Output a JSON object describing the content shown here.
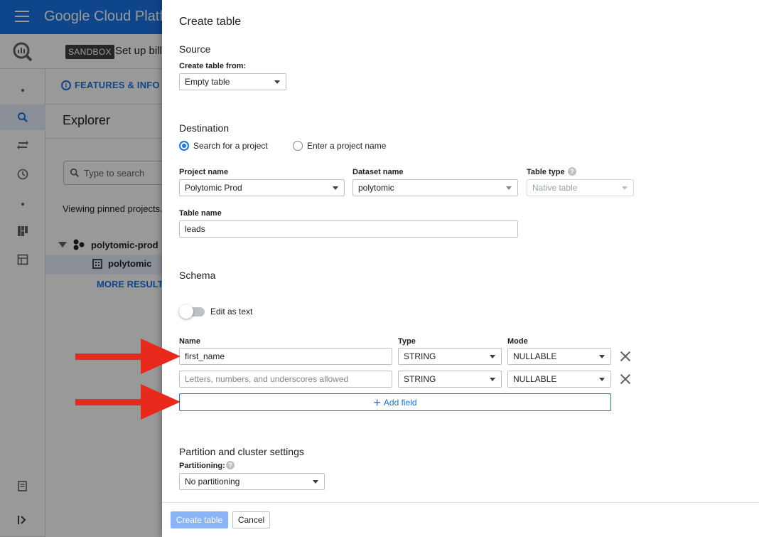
{
  "app": {
    "brand": "Google Cloud Platfo",
    "sandbox_badge": "SANDBOX",
    "setup_text": "Set up bill"
  },
  "left_panel": {
    "features_label": "FEATURES & INFO",
    "explorer_title": "Explorer",
    "search_placeholder": "Type to search",
    "viewing_text": "Viewing pinned projects.",
    "project": "polytomic-prod",
    "dataset": "polytomic",
    "more_results": "MORE RESULTS"
  },
  "dialog": {
    "title": "Create table",
    "source": {
      "heading": "Source",
      "create_from_label": "Create table from:",
      "create_from_value": "Empty table"
    },
    "destination": {
      "heading": "Destination",
      "radio_search": "Search for a project",
      "radio_enter": "Enter a project name",
      "project_label": "Project name",
      "project_value": "Polytomic Prod",
      "dataset_label": "Dataset name",
      "dataset_value": "polytomic",
      "table_type_label": "Table type",
      "table_type_value": "Native table",
      "table_name_label": "Table name",
      "table_name_value": "leads"
    },
    "schema": {
      "heading": "Schema",
      "edit_as_text": "Edit as text",
      "col_name": "Name",
      "col_type": "Type",
      "col_mode": "Mode",
      "rows": [
        {
          "name": "first_name",
          "placeholder": "",
          "type": "STRING",
          "mode": "NULLABLE"
        },
        {
          "name": "",
          "placeholder": "Letters, numbers, and underscores allowed",
          "type": "STRING",
          "mode": "NULLABLE"
        }
      ],
      "add_field": "Add field"
    },
    "partition": {
      "heading": "Partition and cluster settings",
      "partitioning_label": "Partitioning:",
      "partitioning_value": "No partitioning"
    },
    "footer": {
      "create_button": "Create table",
      "cancel_button": "Cancel"
    }
  },
  "colors": {
    "primary": "#1a73e8",
    "arrow": "#e8291c"
  }
}
